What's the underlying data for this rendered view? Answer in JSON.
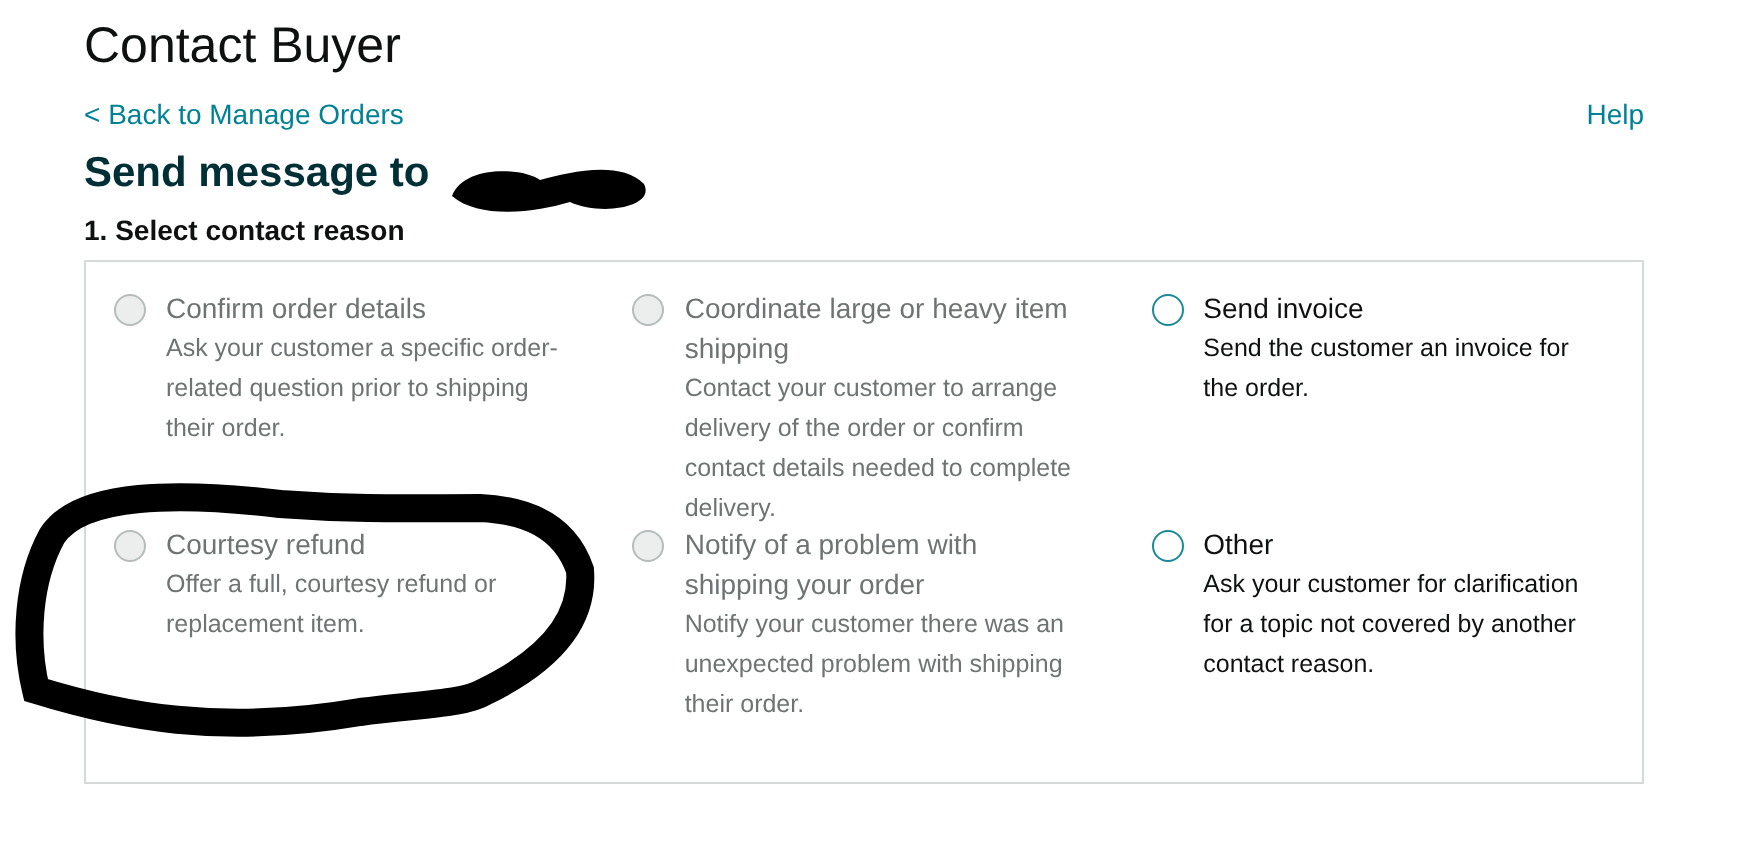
{
  "page_title": "Contact Buyer",
  "back_link": "< Back to Manage Orders",
  "help_link": "Help",
  "heading": "Send message to",
  "step_title": "1. Select contact reason",
  "reasons": [
    {
      "title": "Confirm order details",
      "description": "Ask your customer a specific order-related question prior to shipping their order.",
      "disabled": true,
      "selected": false
    },
    {
      "title": "Coordinate large or heavy item shipping",
      "description": "Contact your customer to arrange delivery of the order or confirm contact details needed to complete delivery.",
      "disabled": true,
      "selected": false
    },
    {
      "title": "Send invoice",
      "description": "Send the customer an invoice for the order.",
      "disabled": false,
      "selected": false
    },
    {
      "title": "Courtesy refund",
      "description": "Offer a full, courtesy refund or replacement item.",
      "disabled": true,
      "selected": false
    },
    {
      "title": "Notify of a problem with shipping your order",
      "description": "Notify your customer there was an unexpected problem with shipping their order.",
      "disabled": true,
      "selected": false
    },
    {
      "title": "Other",
      "description": "Ask your customer for clarification for a topic not covered by another contact reason.",
      "disabled": false,
      "selected": false
    }
  ]
}
